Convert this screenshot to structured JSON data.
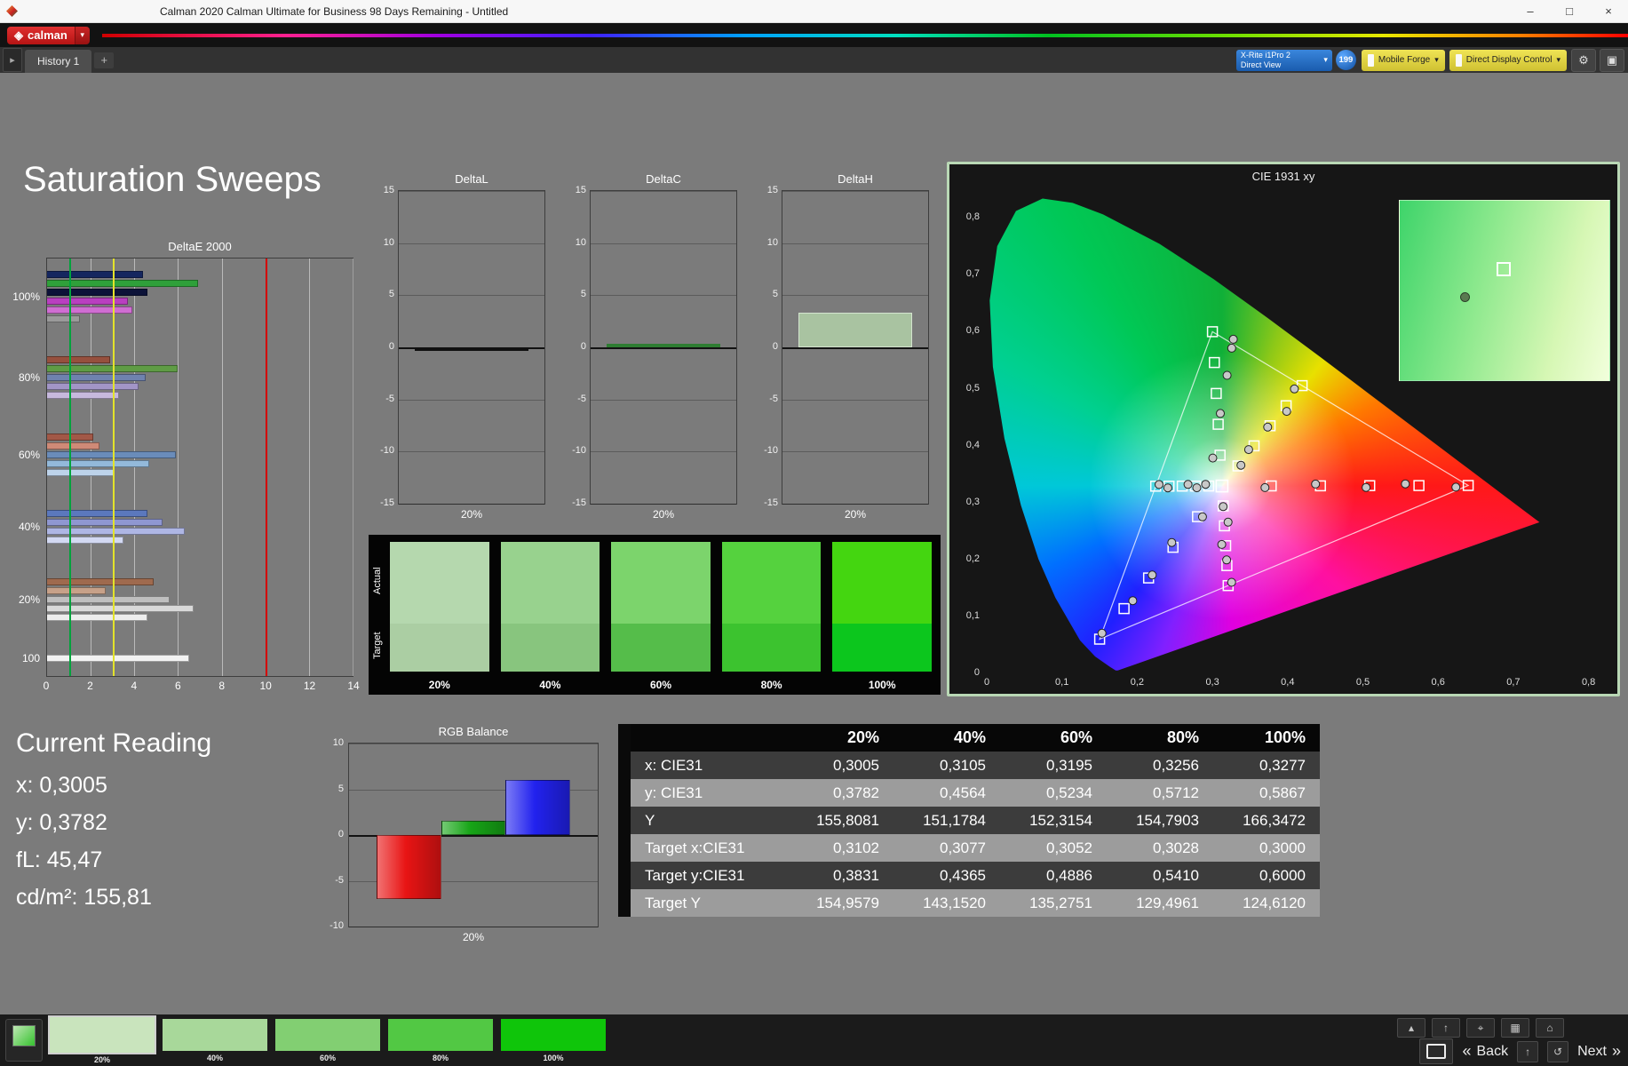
{
  "window": {
    "title": "Calman 2020 Calman Ultimate for Business 98 Days Remaining - Untitled"
  },
  "icons": {
    "chevron_down": "▾",
    "gear": "⚙",
    "layout": "▣",
    "plus": "+",
    "arrow_right": "▸",
    "minimize": "–",
    "maximize": "□",
    "close": "×",
    "back_chevrons": "«",
    "next_chevrons": "»",
    "up_arrow": "↑",
    "refresh": "↺",
    "eject": "▴",
    "probe": "⌖",
    "gamepad": "▦",
    "home": "⌂",
    "brand_diamond": "◈"
  },
  "logo_bar": {
    "brand": "calman"
  },
  "tab_bar": {
    "tabs": [
      {
        "label": "History 1"
      },
      {
        "label": "+"
      }
    ],
    "meter_button": {
      "line1": "X-Rite i1Pro 2",
      "line2": "Direct View"
    },
    "badge": "199",
    "pattern_button": "Mobile Forge",
    "display_button": "Direct Display Control"
  },
  "page": {
    "title": "Saturation Sweeps"
  },
  "current_reading": {
    "title": "Current Reading",
    "lines": [
      "x: 0,3005",
      "y: 0,3782",
      "fL: 45,47",
      "cd/m²: 155,81"
    ]
  },
  "chart_data": {
    "deltaE2000": {
      "type": "bar",
      "orientation": "horizontal",
      "title": "DeltaE 2000",
      "xlim": [
        0,
        14
      ],
      "xticks": [
        0,
        2,
        4,
        6,
        8,
        10,
        12,
        14
      ],
      "reference_lines": [
        {
          "value": 1,
          "color": "#00a33c"
        },
        {
          "value": 3,
          "color": "#e3e32a"
        },
        {
          "value": 10,
          "color": "#d40000"
        }
      ],
      "groups": [
        {
          "label": "100%",
          "bars": [
            {
              "color": "#15265f",
              "value": 4.4
            },
            {
              "color": "#2fa03a",
              "value": 6.9
            },
            {
              "color": "#0c1238",
              "value": 4.6
            },
            {
              "color": "#b93fc0",
              "value": 3.7
            },
            {
              "color": "#cf6ed2",
              "value": 3.9
            },
            {
              "color": "#9a9a9a",
              "value": 1.5
            }
          ]
        },
        {
          "label": "80%",
          "bars": [
            {
              "color": "#96503e",
              "value": 2.9
            },
            {
              "color": "#5f9c45",
              "value": 6.0
            },
            {
              "color": "#6f82ae",
              "value": 4.5
            },
            {
              "color": "#a295c7",
              "value": 4.2
            },
            {
              "color": "#c7b9dd",
              "value": 3.3
            }
          ]
        },
        {
          "label": "60%",
          "bars": [
            {
              "color": "#a25847",
              "value": 2.1
            },
            {
              "color": "#cf8a77",
              "value": 2.4
            },
            {
              "color": "#6a8cba",
              "value": 5.9
            },
            {
              "color": "#93b9da",
              "value": 4.7
            },
            {
              "color": "#bdd3ea",
              "value": 3.1
            }
          ]
        },
        {
          "label": "40%",
          "bars": [
            {
              "color": "#5b78bd",
              "value": 4.6
            },
            {
              "color": "#8f97d1",
              "value": 5.3
            },
            {
              "color": "#aeb6e4",
              "value": 6.3
            },
            {
              "color": "#d3d9f2",
              "value": 3.5
            }
          ]
        },
        {
          "label": "20%",
          "bars": [
            {
              "color": "#9f6a4e",
              "value": 4.9
            },
            {
              "color": "#c7a189",
              "value": 2.7
            },
            {
              "color": "#bfbfbf",
              "value": 5.6
            },
            {
              "color": "#d9d9d9",
              "value": 6.7
            },
            {
              "color": "#ededed",
              "value": 4.6
            }
          ]
        },
        {
          "label": "100",
          "bars": [
            {
              "color": "#f2f2f2",
              "value": 6.5
            }
          ]
        }
      ]
    },
    "deltaL": {
      "type": "bar",
      "title": "DeltaL",
      "ylim": [
        -15,
        15
      ],
      "yticks": [
        15,
        10,
        5,
        0,
        -5,
        -10,
        -15
      ],
      "category": "20%",
      "value": -0.3,
      "color": "#101010"
    },
    "deltaC": {
      "type": "bar",
      "title": "DeltaC",
      "ylim": [
        -15,
        15
      ],
      "yticks": [
        15,
        10,
        5,
        0,
        -5,
        -10,
        -15
      ],
      "category": "20%",
      "value": 0.3,
      "color": "#2e7d32"
    },
    "deltaH": {
      "type": "bar",
      "title": "DeltaH",
      "ylim": [
        -15,
        15
      ],
      "yticks": [
        15,
        10,
        5,
        0,
        -5,
        -10,
        -15
      ],
      "category": "20%",
      "value": 3.3,
      "color": "#a9c3a1",
      "border": "#d4e4cf"
    },
    "rgb_balance": {
      "type": "bar",
      "title": "RGB Balance",
      "ylim": [
        -10,
        10
      ],
      "yticks": [
        10,
        5,
        0,
        -5,
        -10
      ],
      "category": "20%",
      "series": [
        {
          "name": "Red",
          "value": -7.0,
          "color": "#e81414"
        },
        {
          "name": "Green",
          "value": 1.6,
          "color": "#17a517"
        },
        {
          "name": "Blue",
          "value": 6.0,
          "color": "#2222ee"
        }
      ]
    },
    "patches": {
      "rows": [
        "Actual",
        "Target"
      ],
      "columns": [
        "20%",
        "40%",
        "60%",
        "80%",
        "100%"
      ],
      "actual_colors": [
        "#b5d8ae",
        "#98d28e",
        "#7cd46c",
        "#55d23e",
        "#44d610"
      ],
      "target_colors": [
        "#abcea3",
        "#88c57e",
        "#55bd4a",
        "#3cc32f",
        "#0cc61d"
      ]
    },
    "cie1931": {
      "type": "scatter",
      "title": "CIE 1931 xy",
      "xlim": [
        0,
        0.8
      ],
      "ylim": [
        0,
        0.85
      ],
      "xticks": [
        "0",
        "0,1",
        "0,2",
        "0,3",
        "0,4",
        "0,5",
        "0,6",
        "0,7",
        "0,8"
      ],
      "yticks": [
        "0",
        "0,1",
        "0,2",
        "0,3",
        "0,4",
        "0,5",
        "0,6",
        "0,7",
        "0,8"
      ],
      "white_point": {
        "x": 0.3127,
        "y": 0.329
      },
      "primaries": {
        "R": [
          0.64,
          0.33
        ],
        "G": [
          0.3,
          0.6
        ],
        "B": [
          0.15,
          0.06
        ],
        "C": [
          0.2246,
          0.3287
        ],
        "M": [
          0.3209,
          0.1542
        ],
        "Y": [
          0.4193,
          0.5053
        ]
      },
      "saturation_levels": [
        0.2,
        0.4,
        0.6,
        0.8,
        1.0
      ],
      "measured": [
        {
          "x": 0.3005,
          "y": 0.3782
        },
        {
          "x": 0.3105,
          "y": 0.4564
        },
        {
          "x": 0.3195,
          "y": 0.5234
        },
        {
          "x": 0.3256,
          "y": 0.5712
        },
        {
          "x": 0.3277,
          "y": 0.5867
        }
      ]
    },
    "results_table": {
      "type": "table",
      "columns": [
        "20%",
        "40%",
        "60%",
        "80%",
        "100%"
      ],
      "rows": [
        {
          "label": "x: CIE31",
          "values": [
            "0,3005",
            "0,3105",
            "0,3195",
            "0,3256",
            "0,3277"
          ]
        },
        {
          "label": "y: CIE31",
          "values": [
            "0,3782",
            "0,4564",
            "0,5234",
            "0,5712",
            "0,5867"
          ]
        },
        {
          "label": "Y",
          "values": [
            "155,8081",
            "151,1784",
            "152,3154",
            "154,7903",
            "166,3472"
          ]
        },
        {
          "label": "Target x:CIE31",
          "values": [
            "0,3102",
            "0,3077",
            "0,3052",
            "0,3028",
            "0,3000"
          ]
        },
        {
          "label": "Target y:CIE31",
          "values": [
            "0,3831",
            "0,4365",
            "0,4886",
            "0,5410",
            "0,6000"
          ]
        },
        {
          "label": "Target Y",
          "values": [
            "154,9579",
            "143,1520",
            "135,2751",
            "129,4961",
            "124,6120"
          ]
        }
      ]
    }
  },
  "bottom_bar": {
    "back_label": "Back",
    "next_label": "Next",
    "thumbnails": [
      {
        "label": "20%",
        "color": "#c9e4bd"
      },
      {
        "label": "40%",
        "color": "#a8d89a"
      },
      {
        "label": "60%",
        "color": "#82cf72"
      },
      {
        "label": "80%",
        "color": "#52c844"
      },
      {
        "label": "100%",
        "color": "#0fc50a"
      }
    ]
  }
}
